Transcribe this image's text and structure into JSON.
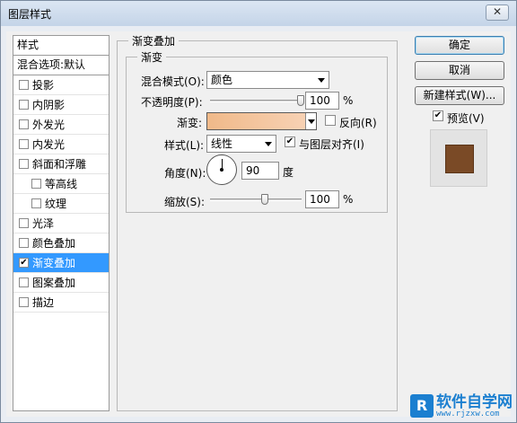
{
  "window": {
    "title": "图层样式",
    "close_label": "✕"
  },
  "styles_list": {
    "header": "样式",
    "blend_options": "混合选项:默认",
    "items": [
      {
        "label": "投影",
        "checked": false,
        "sub": false,
        "selected": false
      },
      {
        "label": "内阴影",
        "checked": false,
        "sub": false,
        "selected": false
      },
      {
        "label": "外发光",
        "checked": false,
        "sub": false,
        "selected": false
      },
      {
        "label": "内发光",
        "checked": false,
        "sub": false,
        "selected": false
      },
      {
        "label": "斜面和浮雕",
        "checked": false,
        "sub": false,
        "selected": false
      },
      {
        "label": "等高线",
        "checked": false,
        "sub": true,
        "selected": false
      },
      {
        "label": "纹理",
        "checked": false,
        "sub": true,
        "selected": false
      },
      {
        "label": "光泽",
        "checked": false,
        "sub": false,
        "selected": false
      },
      {
        "label": "颜色叠加",
        "checked": false,
        "sub": false,
        "selected": false
      },
      {
        "label": "渐变叠加",
        "checked": true,
        "sub": false,
        "selected": true
      },
      {
        "label": "图案叠加",
        "checked": false,
        "sub": false,
        "selected": false
      },
      {
        "label": "描边",
        "checked": false,
        "sub": false,
        "selected": false
      }
    ]
  },
  "panel": {
    "title": "渐变叠加",
    "group_title": "渐变",
    "blend_mode_label": "混合模式(O):",
    "blend_mode_value": "颜色",
    "opacity_label": "不透明度(P):",
    "opacity_value": "100",
    "opacity_unit": "%",
    "opacity_fraction": 1.0,
    "gradient_label": "渐变:",
    "gradient_colors": [
      "#f0b989",
      "#f8d4b8"
    ],
    "reverse_label": "反向(R)",
    "reverse_checked": false,
    "style_label": "样式(L):",
    "style_value": "线性",
    "align_label": "与图层对齐(I)",
    "align_checked": true,
    "angle_label": "角度(N):",
    "angle_value": "90",
    "angle_unit": "度",
    "scale_label": "缩放(S):",
    "scale_value": "100",
    "scale_unit": "%",
    "scale_fraction": 0.6
  },
  "buttons": {
    "ok": "确定",
    "cancel": "取消",
    "new_style": "新建样式(W)...",
    "preview_label": "预览(V)",
    "preview_checked": true
  },
  "preview": {
    "swatch_color": "#7a4a26"
  },
  "watermark": {
    "logo": "R",
    "main": "软件自学网",
    "sub": "www.rjzxw.com"
  }
}
